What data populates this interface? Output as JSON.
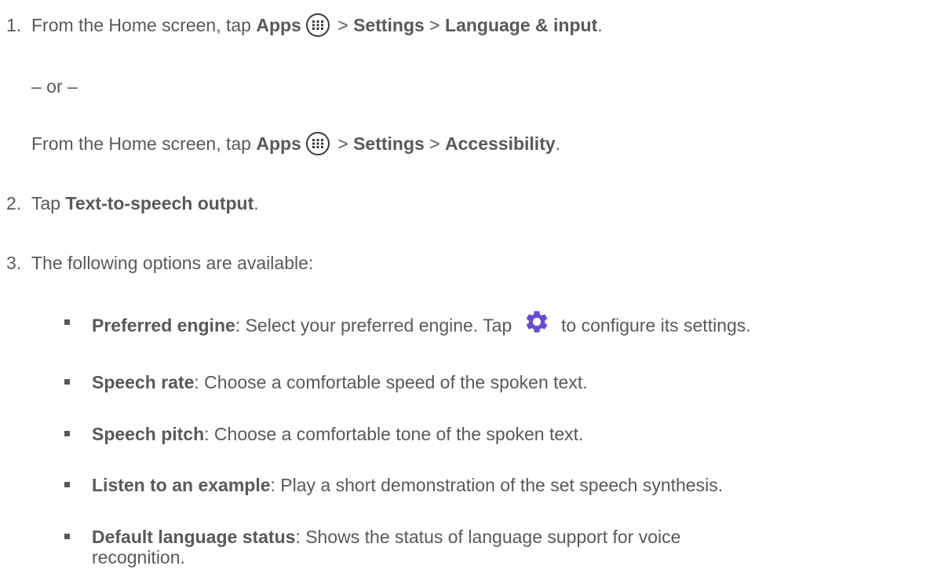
{
  "steps": [
    {
      "number": "1.",
      "pre": "From the Home screen, tap ",
      "apps_label": "Apps",
      "sep1": " > ",
      "settings_label": "Settings",
      "sep2": " > ",
      "target": "Language & input",
      "end": "."
    },
    {
      "number": "2.",
      "pre": "Tap ",
      "target": "Text-to-speech output",
      "end": "."
    },
    {
      "number": "3.",
      "text": "The following options are available:"
    }
  ],
  "or_text": "– or –",
  "alt_step": {
    "pre": "From the Home screen, tap ",
    "apps_label": "Apps",
    "sep1": " > ",
    "settings_label": "Settings",
    "sep2": " > ",
    "target": "Accessibility",
    "end": "."
  },
  "options": [
    {
      "title": "Preferred engine",
      "desc_pre": ": Select your preferred engine. Tap ",
      "desc_post": " to configure its settings."
    },
    {
      "title": "Speech rate",
      "desc": ": Choose a comfortable speed of the spoken text."
    },
    {
      "title": "Speech pitch",
      "desc": ": Choose a comfortable tone of the spoken text."
    },
    {
      "title": "Listen to an example",
      "desc": ": Play a short demonstration of the set speech synthesis."
    },
    {
      "title": "Default language status",
      "desc": ": Shows the status of language support for voice",
      "desc_cont": "recognition."
    }
  ],
  "icons": {
    "apps": "apps-grid-icon",
    "gear": "gear-icon"
  },
  "colors": {
    "text": "#595959",
    "gear": "#6a49d9",
    "icon_stroke": "#3a3a3a"
  }
}
